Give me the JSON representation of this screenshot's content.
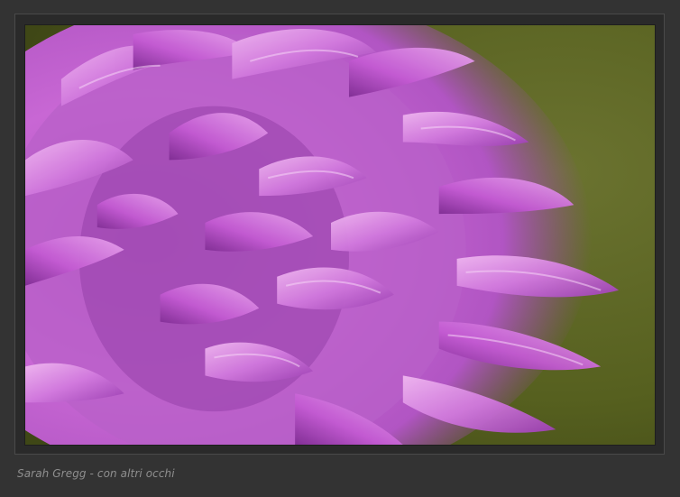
{
  "caption": {
    "text": "Sarah Gregg - con altri occhi"
  },
  "photo": {
    "subject-icon": "orchid-flower-macro",
    "colors": {
      "background": "#5f6624",
      "petal_light": "#e6a0e6",
      "petal_mid": "#c45fd0",
      "petal_dark": "#7a2a8a",
      "frame": "#333333"
    }
  }
}
